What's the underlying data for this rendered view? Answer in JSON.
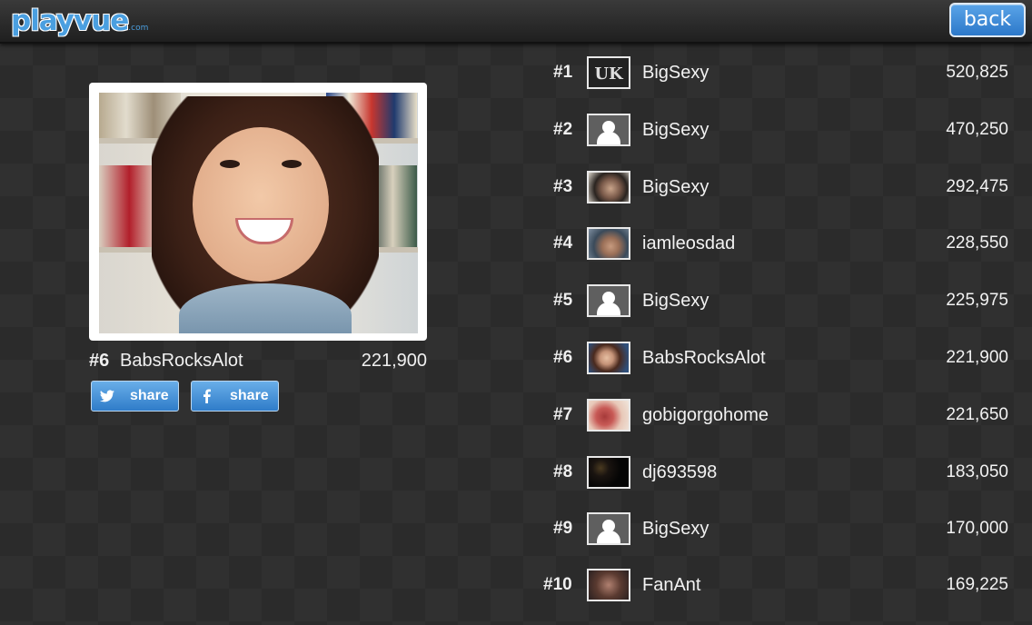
{
  "header": {
    "logo_text": "playvue",
    "logo_suffix": ".com",
    "back_label": "back"
  },
  "featured": {
    "rank": "#6",
    "name": "BabsRocksAlot",
    "score": "221,900",
    "twitter_share": "share",
    "facebook_share": "share"
  },
  "leaderboard": [
    {
      "rank": "#1",
      "name": "BigSexy",
      "score": "520,825",
      "avatar": "uk-logo"
    },
    {
      "rank": "#2",
      "name": "BigSexy",
      "score": "470,250",
      "avatar": "placeholder"
    },
    {
      "rank": "#3",
      "name": "BigSexy",
      "score": "292,475",
      "avatar": "photo"
    },
    {
      "rank": "#4",
      "name": "iamleosdad",
      "score": "228,550",
      "avatar": "photo"
    },
    {
      "rank": "#5",
      "name": "BigSexy",
      "score": "225,975",
      "avatar": "placeholder"
    },
    {
      "rank": "#6",
      "name": "BabsRocksAlot",
      "score": "221,900",
      "avatar": "photo"
    },
    {
      "rank": "#7",
      "name": "gobigorgohome",
      "score": "221,650",
      "avatar": "photo"
    },
    {
      "rank": "#8",
      "name": "dj693598",
      "score": "183,050",
      "avatar": "dark"
    },
    {
      "rank": "#9",
      "name": "BigSexy",
      "score": "170,000",
      "avatar": "placeholder"
    },
    {
      "rank": "#10",
      "name": "FanAnt",
      "score": "169,225",
      "avatar": "photo"
    }
  ]
}
